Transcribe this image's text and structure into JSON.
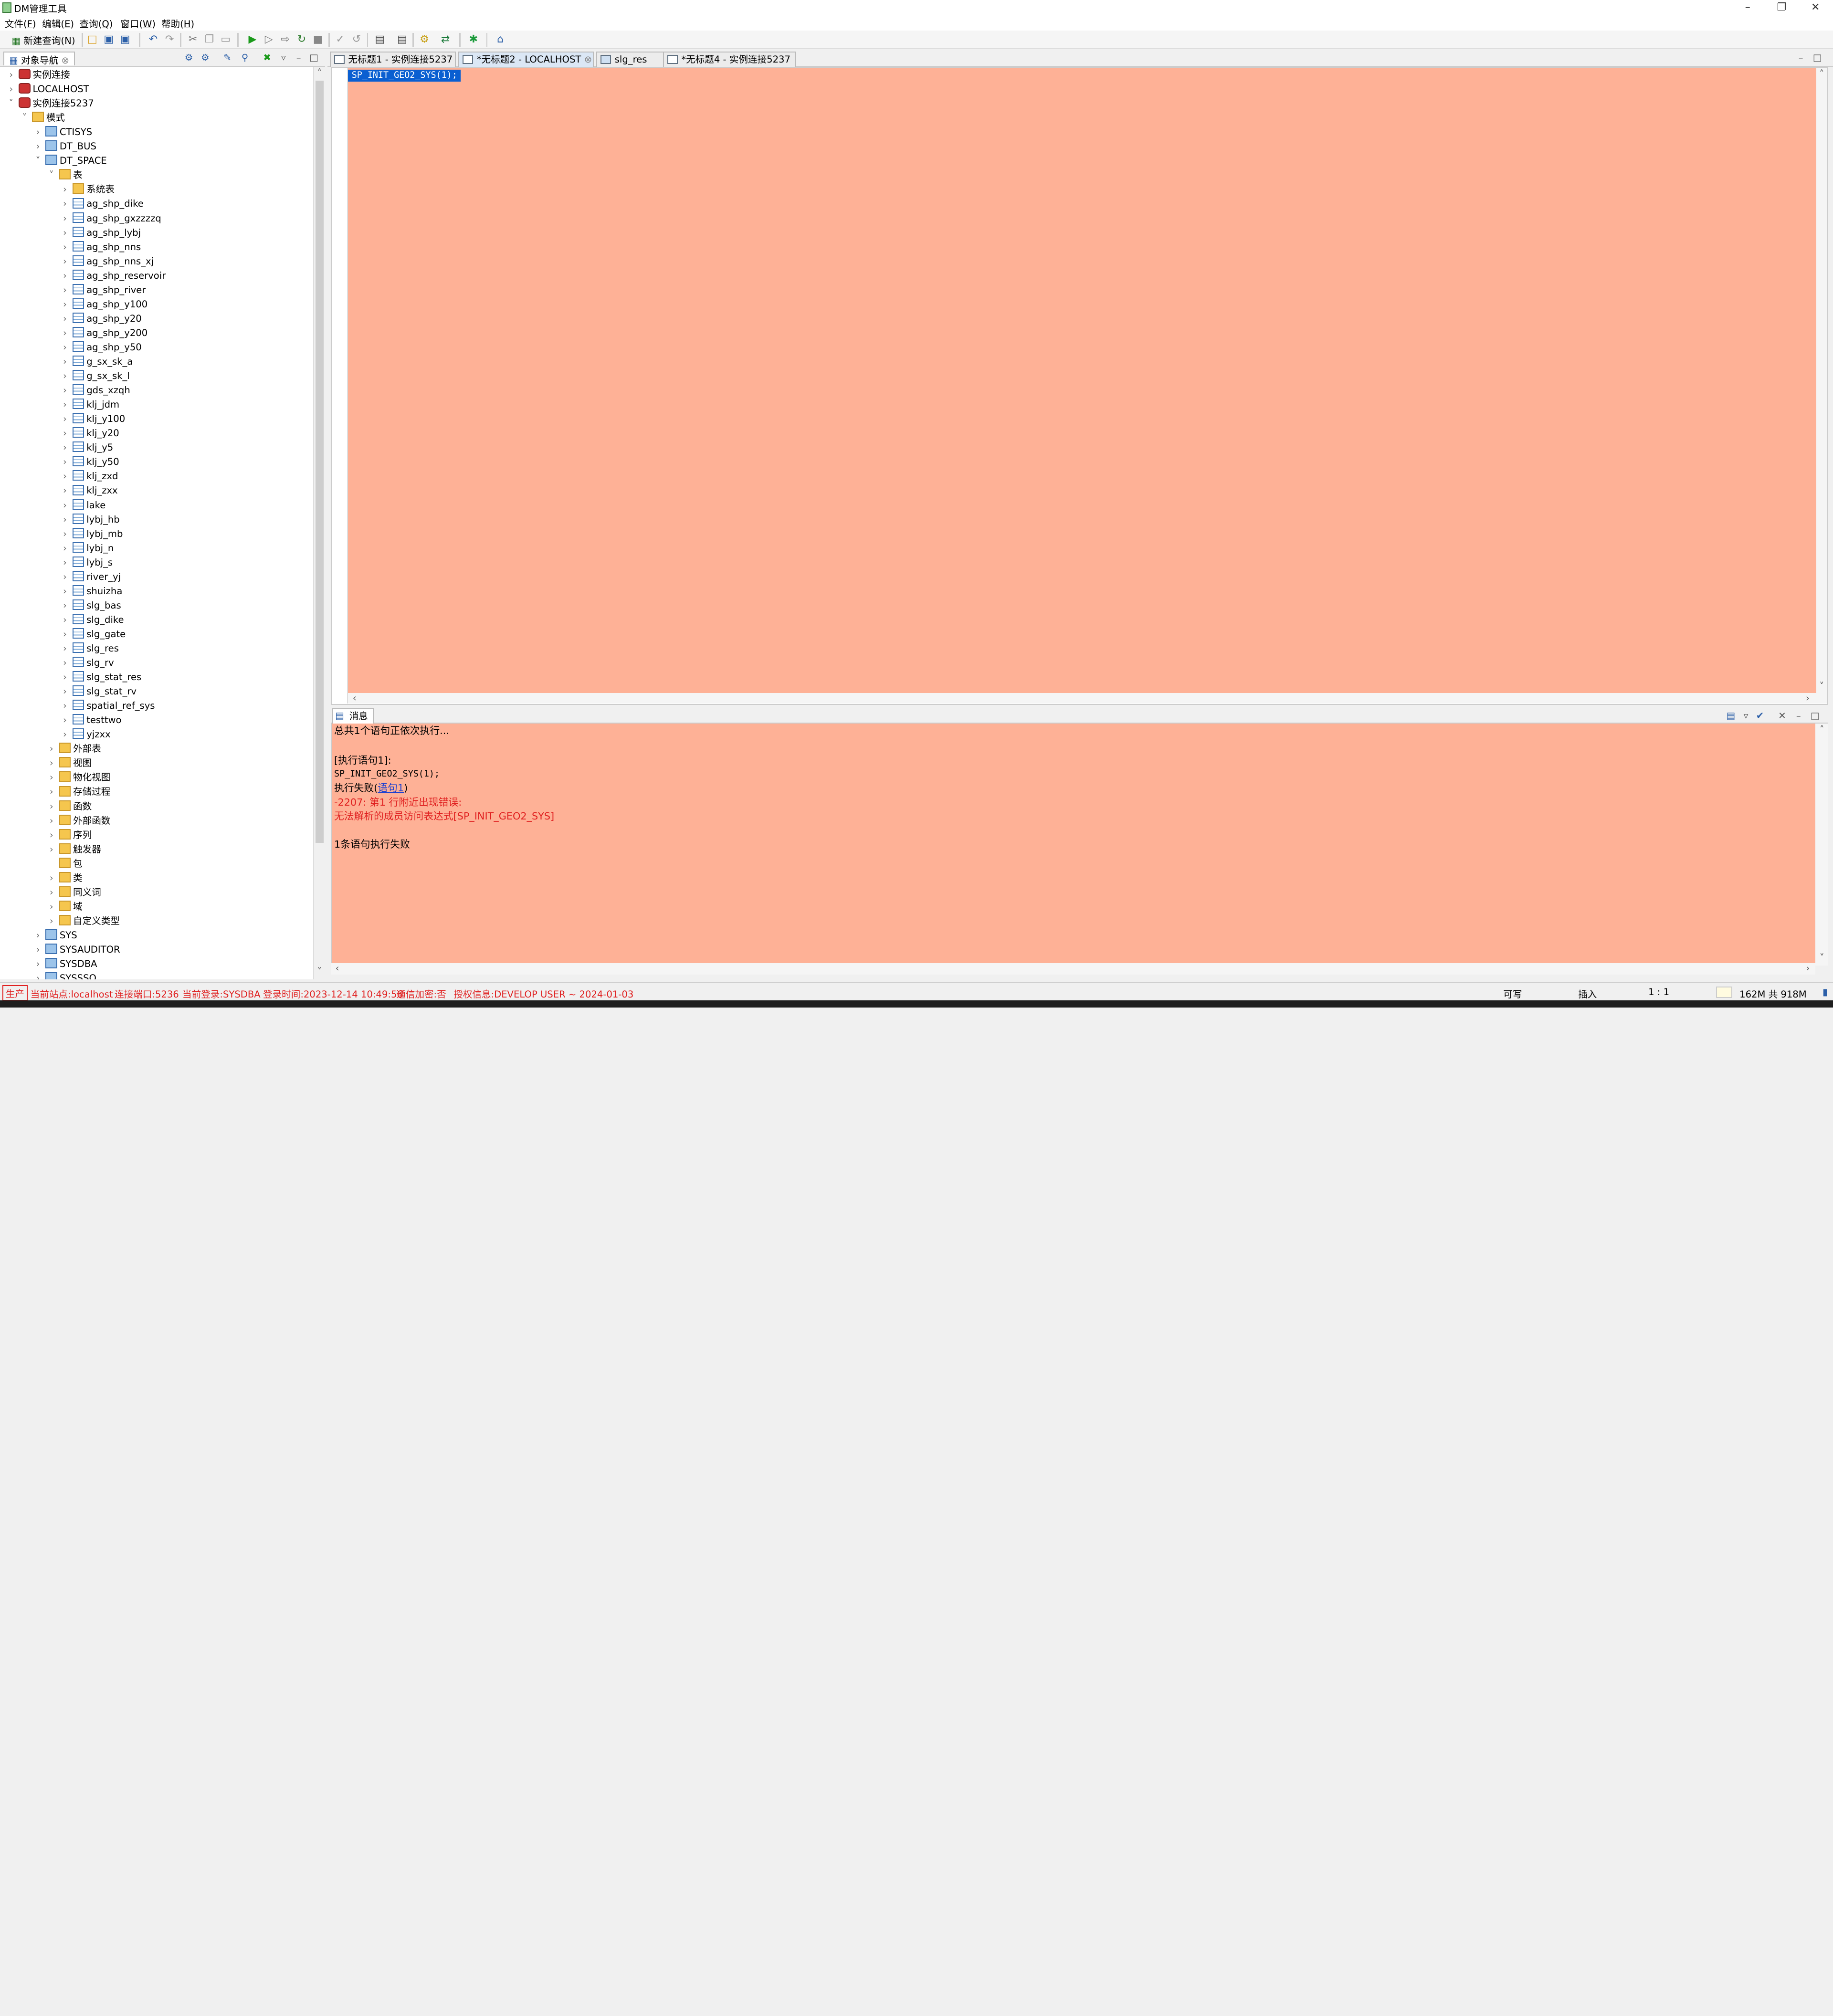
{
  "window": {
    "title": "DM管理工具",
    "minimize_icon": "minimize-icon",
    "restore_icon": "restore-icon",
    "close_icon": "close-icon"
  },
  "menu": [
    {
      "label": "文件(",
      "key": "F",
      "end": ")"
    },
    {
      "label": "编辑(",
      "key": "E",
      "end": ")"
    },
    {
      "label": "查询(",
      "key": "Q",
      "end": ")"
    },
    {
      "label": "窗口(",
      "key": "W",
      "end": ")"
    },
    {
      "label": "帮助(",
      "key": "H",
      "end": ")"
    }
  ],
  "toolbar": {
    "new_query": "新建查询(N)"
  },
  "nav": {
    "title": "对象导航",
    "items": [
      {
        "label": "实例连接",
        "level": 0,
        "arrow": "right",
        "icon": "db"
      },
      {
        "label": "LOCALHOST",
        "level": 0,
        "arrow": "right",
        "icon": "db"
      },
      {
        "label": "实例连接5237",
        "level": 0,
        "arrow": "down",
        "icon": "db"
      },
      {
        "label": "模式",
        "level": 1,
        "arrow": "down",
        "icon": "folder"
      },
      {
        "label": "CTISYS",
        "level": 2,
        "arrow": "right",
        "icon": "schema"
      },
      {
        "label": "DT_BUS",
        "level": 2,
        "arrow": "right",
        "icon": "schema"
      },
      {
        "label": "DT_SPACE",
        "level": 2,
        "arrow": "down",
        "icon": "schema"
      },
      {
        "label": "表",
        "level": 3,
        "arrow": "down",
        "icon": "folder"
      },
      {
        "label": "系统表",
        "level": 4,
        "arrow": "right",
        "icon": "folder"
      },
      {
        "label": "ag_shp_dike",
        "level": 4,
        "arrow": "right",
        "icon": "table"
      },
      {
        "label": "ag_shp_gxzzzzq",
        "level": 4,
        "arrow": "right",
        "icon": "table"
      },
      {
        "label": "ag_shp_lybj",
        "level": 4,
        "arrow": "right",
        "icon": "table"
      },
      {
        "label": "ag_shp_nns",
        "level": 4,
        "arrow": "right",
        "icon": "table"
      },
      {
        "label": "ag_shp_nns_xj",
        "level": 4,
        "arrow": "right",
        "icon": "table"
      },
      {
        "label": "ag_shp_reservoir",
        "level": 4,
        "arrow": "right",
        "icon": "table"
      },
      {
        "label": "ag_shp_river",
        "level": 4,
        "arrow": "right",
        "icon": "table"
      },
      {
        "label": "ag_shp_y100",
        "level": 4,
        "arrow": "right",
        "icon": "table"
      },
      {
        "label": "ag_shp_y20",
        "level": 4,
        "arrow": "right",
        "icon": "table"
      },
      {
        "label": "ag_shp_y200",
        "level": 4,
        "arrow": "right",
        "icon": "table"
      },
      {
        "label": "ag_shp_y50",
        "level": 4,
        "arrow": "right",
        "icon": "table"
      },
      {
        "label": "g_sx_sk_a",
        "level": 4,
        "arrow": "right",
        "icon": "table"
      },
      {
        "label": "g_sx_sk_l",
        "level": 4,
        "arrow": "right",
        "icon": "table"
      },
      {
        "label": "gds_xzqh",
        "level": 4,
        "arrow": "right",
        "icon": "table"
      },
      {
        "label": "klj_jdm",
        "level": 4,
        "arrow": "right",
        "icon": "table"
      },
      {
        "label": "klj_y100",
        "level": 4,
        "arrow": "right",
        "icon": "table"
      },
      {
        "label": "klj_y20",
        "level": 4,
        "arrow": "right",
        "icon": "table"
      },
      {
        "label": "klj_y5",
        "level": 4,
        "arrow": "right",
        "icon": "table"
      },
      {
        "label": "klj_y50",
        "level": 4,
        "arrow": "right",
        "icon": "table"
      },
      {
        "label": "klj_zxd",
        "level": 4,
        "arrow": "right",
        "icon": "table"
      },
      {
        "label": "klj_zxx",
        "level": 4,
        "arrow": "right",
        "icon": "table"
      },
      {
        "label": "lake",
        "level": 4,
        "arrow": "right",
        "icon": "table"
      },
      {
        "label": "lybj_hb",
        "level": 4,
        "arrow": "right",
        "icon": "table"
      },
      {
        "label": "lybj_mb",
        "level": 4,
        "arrow": "right",
        "icon": "table"
      },
      {
        "label": "lybj_n",
        "level": 4,
        "arrow": "right",
        "icon": "table"
      },
      {
        "label": "lybj_s",
        "level": 4,
        "arrow": "right",
        "icon": "table"
      },
      {
        "label": "river_yj",
        "level": 4,
        "arrow": "right",
        "icon": "table"
      },
      {
        "label": "shuizha",
        "level": 4,
        "arrow": "right",
        "icon": "table"
      },
      {
        "label": "slg_bas",
        "level": 4,
        "arrow": "right",
        "icon": "table"
      },
      {
        "label": "slg_dike",
        "level": 4,
        "arrow": "right",
        "icon": "table"
      },
      {
        "label": "slg_gate",
        "level": 4,
        "arrow": "right",
        "icon": "table"
      },
      {
        "label": "slg_res",
        "level": 4,
        "arrow": "right",
        "icon": "table"
      },
      {
        "label": "slg_rv",
        "level": 4,
        "arrow": "right",
        "icon": "table"
      },
      {
        "label": "slg_stat_res",
        "level": 4,
        "arrow": "right",
        "icon": "table"
      },
      {
        "label": "slg_stat_rv",
        "level": 4,
        "arrow": "right",
        "icon": "table"
      },
      {
        "label": "spatial_ref_sys",
        "level": 4,
        "arrow": "right",
        "icon": "table"
      },
      {
        "label": "testtwo",
        "level": 4,
        "arrow": "right",
        "icon": "table"
      },
      {
        "label": "yjzxx",
        "level": 4,
        "arrow": "right",
        "icon": "table"
      },
      {
        "label": "外部表",
        "level": 3,
        "arrow": "right",
        "icon": "folder"
      },
      {
        "label": "视图",
        "level": 3,
        "arrow": "right",
        "icon": "folder"
      },
      {
        "label": "物化视图",
        "level": 3,
        "arrow": "right",
        "icon": "folder"
      },
      {
        "label": "存储过程",
        "level": 3,
        "arrow": "right",
        "icon": "folder"
      },
      {
        "label": "函数",
        "level": 3,
        "arrow": "right",
        "icon": "folder"
      },
      {
        "label": "外部函数",
        "level": 3,
        "arrow": "right",
        "icon": "folder"
      },
      {
        "label": "序列",
        "level": 3,
        "arrow": "right",
        "icon": "folder"
      },
      {
        "label": "触发器",
        "level": 3,
        "arrow": "right",
        "icon": "folder"
      },
      {
        "label": "包",
        "level": 3,
        "arrow": "none",
        "icon": "folder"
      },
      {
        "label": "类",
        "level": 3,
        "arrow": "right",
        "icon": "folder"
      },
      {
        "label": "同义词",
        "level": 3,
        "arrow": "right",
        "icon": "folder"
      },
      {
        "label": "域",
        "level": 3,
        "arrow": "right",
        "icon": "folder"
      },
      {
        "label": "自定义类型",
        "level": 3,
        "arrow": "right",
        "icon": "folder"
      },
      {
        "label": "SYS",
        "level": 2,
        "arrow": "right",
        "icon": "schema"
      },
      {
        "label": "SYSAUDITOR",
        "level": 2,
        "arrow": "right",
        "icon": "schema"
      },
      {
        "label": "SYSDBA",
        "level": 2,
        "arrow": "right",
        "icon": "schema"
      },
      {
        "label": "SYSSSO",
        "level": 2,
        "arrow": "right",
        "icon": "schema"
      }
    ]
  },
  "tabs": [
    {
      "label": "无标题1 - 实例连接5237",
      "active": false
    },
    {
      "label": "*无标题2 - LOCALHOST",
      "active": true
    },
    {
      "label": "slg_res",
      "active": false
    },
    {
      "label": "*无标题4 - 实例连接5237",
      "active": false
    }
  ],
  "editor": {
    "code": "SP_INIT_GEO2_SYS(1);"
  },
  "messages": {
    "title": "消息",
    "line1": "总共1个语句正依次执行...",
    "line2": "[执行语句1]:",
    "line3": "SP_INIT_GEO2_SYS(1);",
    "line4a": "执行失败(",
    "line4link": "语句1",
    "line4b": ")",
    "line5": "-2207: 第1 行附近出现错误:",
    "line6": "无法解析的成员访问表达式[SP_INIT_GEO2_SYS]",
    "line7": "1条语句执行失败"
  },
  "status": {
    "env": "生产",
    "site": "当前站点:localhost",
    "port": "连接端口:5236",
    "login": "当前登录:SYSDBA",
    "time": "登录时间:2023-12-14 10:49:56",
    "encrypt": "通信加密:否",
    "license": "授权信息:DEVELOP USER ~ 2024-01-03",
    "writable": "可写",
    "insert": "插入",
    "pos": "1 : 1",
    "memory": "162M 共 918M"
  },
  "colors": {
    "editor_bg": "#feb196",
    "error": "#e02020",
    "selection": "#0a5fd1"
  }
}
